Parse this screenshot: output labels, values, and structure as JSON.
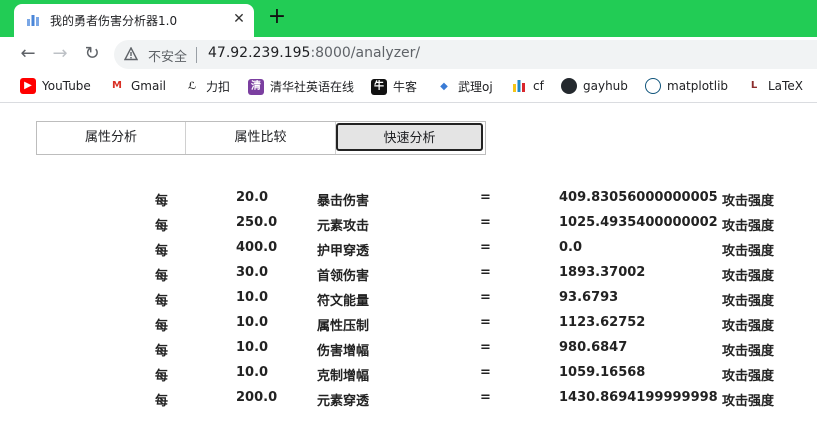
{
  "browser": {
    "tab_title": "我的勇者伤害分析器1.0",
    "tab_close": "✕",
    "new_tab": "+",
    "insecure_label": "不安全",
    "url_host": "47.92.239.195",
    "url_path": ":8000/analyzer/",
    "nav": {
      "back": "←",
      "forward": "→",
      "reload": "↻"
    }
  },
  "bookmarks": [
    {
      "label": "YouTube",
      "icon": "youtube-icon",
      "icon_glyph": "▶",
      "color": "#ff0000"
    },
    {
      "label": "Gmail",
      "icon": "gmail-icon",
      "icon_glyph": "M",
      "color": "#d93025"
    },
    {
      "label": "力扣",
      "icon": "leetcode-icon",
      "icon_glyph": "ℒ",
      "color": "#333333"
    },
    {
      "label": "清华社英语在线",
      "icon": "tsinghua-icon",
      "icon_glyph": "清",
      "color": "#7b3fa0"
    },
    {
      "label": "牛客",
      "icon": "nowcoder-icon",
      "icon_glyph": "牛",
      "color": "#111111"
    },
    {
      "label": "武理oj",
      "icon": "whut-oj-icon",
      "icon_glyph": "◆",
      "color": "#3a7bd5"
    },
    {
      "label": "cf",
      "icon": "codeforces-icon",
      "icon_glyph": "▮",
      "color": "#1f8acb"
    },
    {
      "label": "gayhub",
      "icon": "github-icon",
      "icon_glyph": "●",
      "color": "#24292e"
    },
    {
      "label": "matplotlib",
      "icon": "matplotlib-icon",
      "icon_glyph": "◎",
      "color": "#11557c"
    },
    {
      "label": "LaTeX",
      "icon": "latex-icon",
      "icon_glyph": "L",
      "color": "#8b2c2c"
    }
  ],
  "segments": {
    "attribute_analysis": "属性分析",
    "attribute_compare": "属性比较",
    "quick_analysis": "快速分析",
    "selected": "quick_analysis"
  },
  "results": {
    "per_label": "每",
    "equals": "=",
    "unit": "攻击强度",
    "rows": [
      {
        "amount": "20.0",
        "attribute": "暴击伤害",
        "value": "409.83056000000005"
      },
      {
        "amount": "250.0",
        "attribute": "元素攻击",
        "value": "1025.4935400000002"
      },
      {
        "amount": "400.0",
        "attribute": "护甲穿透",
        "value": "0.0"
      },
      {
        "amount": "30.0",
        "attribute": "首领伤害",
        "value": "1893.37002"
      },
      {
        "amount": "10.0",
        "attribute": "符文能量",
        "value": "93.6793"
      },
      {
        "amount": "10.0",
        "attribute": "属性压制",
        "value": "1123.62752"
      },
      {
        "amount": "10.0",
        "attribute": "伤害增幅",
        "value": "980.6847"
      },
      {
        "amount": "10.0",
        "attribute": "克制增幅",
        "value": "1059.16568"
      },
      {
        "amount": "200.0",
        "attribute": "元素穿透",
        "value": "1430.8694199999998"
      }
    ]
  },
  "colors": {
    "tabstrip": "#22cc55",
    "omnibox": "#f1f3f4",
    "selected_segment_bg": "#e4e4e4"
  }
}
